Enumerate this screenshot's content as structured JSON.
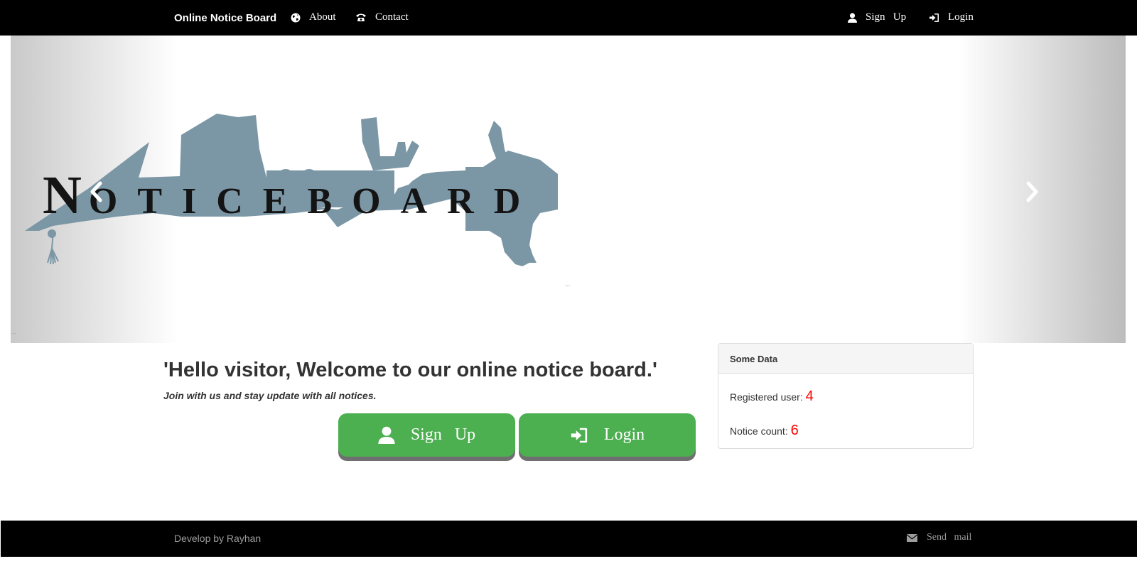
{
  "navbar": {
    "brand": "Online Notice Board",
    "about": "About",
    "contact": "Contact",
    "signup": "Sign   Up",
    "login": "Login",
    "icons": {
      "about": "globe-icon",
      "contact": "phone-icon",
      "signup": "user-icon",
      "login": "log-in-icon"
    }
  },
  "carousel": {
    "logo_first_letter": "N",
    "logo_rest": "OTICEBOARD",
    "prev_icon": "chevron-left-icon",
    "next_icon": "chevron-right-icon",
    "tiny_mark": "..."
  },
  "welcome": {
    "title": "'Hello visitor, Welcome to our online notice board.'",
    "subtitle": "Join with us and stay update with all notices."
  },
  "buttons": {
    "signup": "Sign   Up",
    "login": "Login",
    "color": "#4caf50"
  },
  "panel": {
    "heading": "Some Data",
    "registered_label": "Registered user:",
    "registered_value": "4",
    "notice_label": "Notice count:",
    "notice_value": "6",
    "value_color": "#ff0000"
  },
  "footer": {
    "credit": "Develop by Rayhan",
    "mail": "Send   mail",
    "mail_icon": "envelope-icon"
  }
}
